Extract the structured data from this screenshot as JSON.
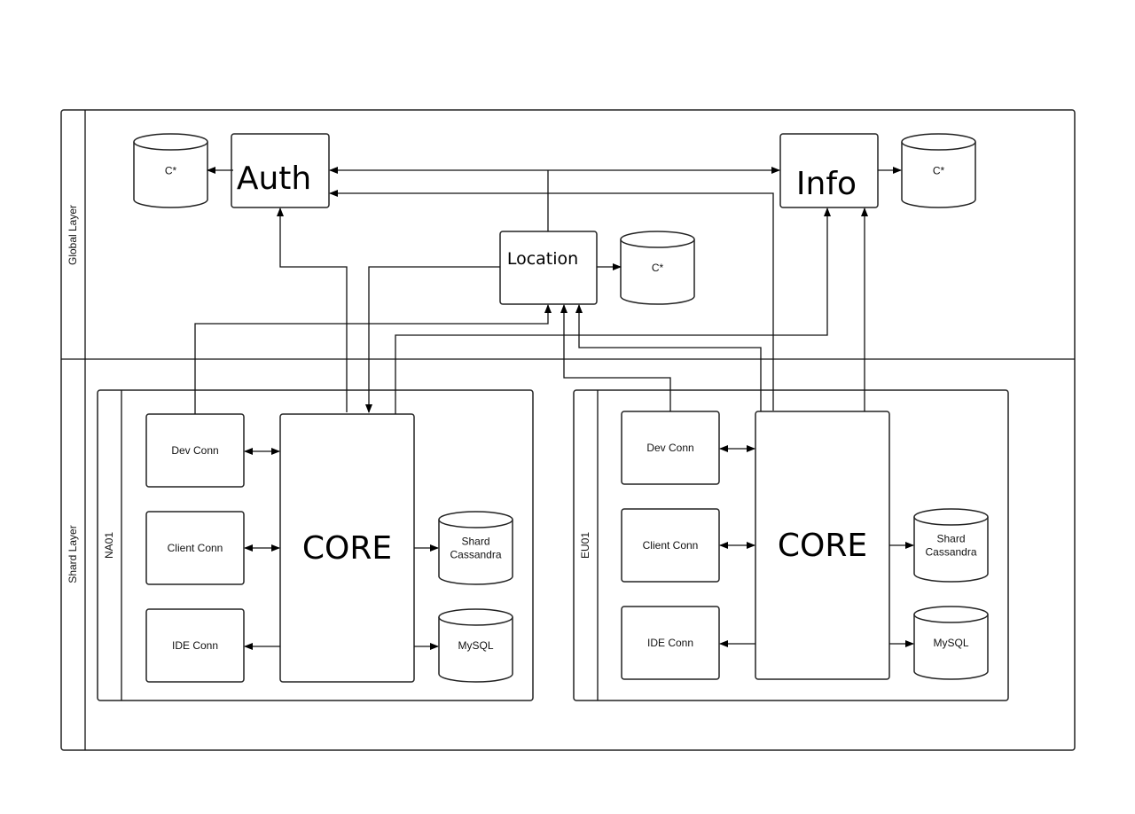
{
  "lanes": {
    "global": "Global Layer",
    "shard": "Shard Layer"
  },
  "global": {
    "auth": "Auth",
    "info": "Info",
    "location": "Location",
    "auth_db": "C*",
    "info_db": "C*",
    "location_db": "C*"
  },
  "shards": [
    {
      "name": "NA01",
      "dev": "Dev Conn",
      "client": "Client Conn",
      "ide": "IDE Conn",
      "core": "CORE",
      "cass1": "Shard",
      "cass2": "Cassandra",
      "mysql": "MySQL"
    },
    {
      "name": "EU01",
      "dev": "Dev Conn",
      "client": "Client Conn",
      "ide": "IDE Conn",
      "core": "CORE",
      "cass1": "Shard",
      "cass2": "Cassandra",
      "mysql": "MySQL"
    }
  ]
}
